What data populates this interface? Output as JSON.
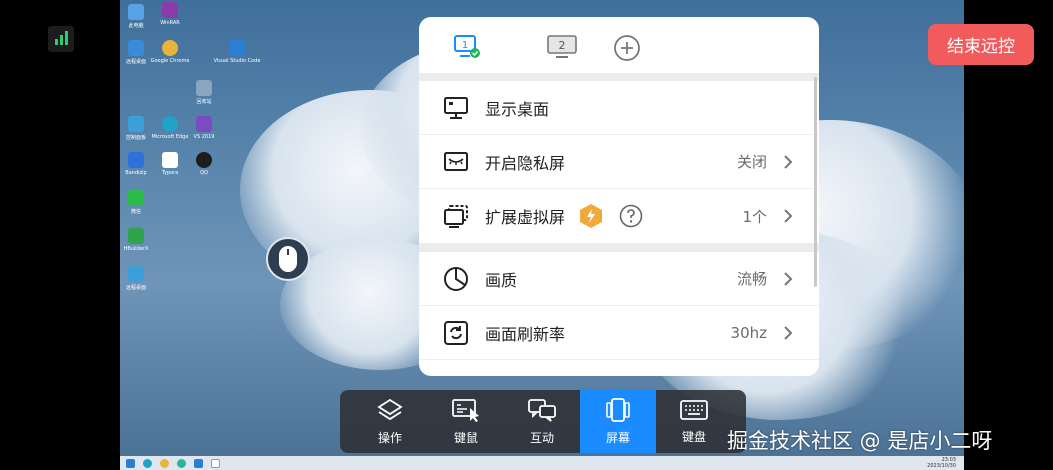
{
  "desktop": {
    "icons": [
      {
        "label": "此电脑",
        "color": "#5aa2e6"
      },
      {
        "label": "WinRAR",
        "color": "#8b3ca8"
      },
      {
        "label": "远程桌面",
        "color": "#3b8ad9"
      },
      {
        "label": "Google Chrome",
        "color": "#e8b53a"
      },
      {
        "label": "Visual Studio Code",
        "color": "#2a7fd4"
      },
      {
        "label": "回收站",
        "color": "#8aa5c0"
      },
      {
        "label": "Microsoft Edge",
        "color": "#1fa3c9"
      },
      {
        "label": "VS 2019",
        "color": "#7b4bc4"
      },
      {
        "label": "Bandizip",
        "color": "#2f6fd8"
      },
      {
        "label": "Typora",
        "color": "#ffffff"
      },
      {
        "label": "QQ",
        "color": "#1d1d1d"
      },
      {
        "label": "微信",
        "color": "#2dbb4c"
      },
      {
        "label": "HBuilderX",
        "color": "#2ea44f"
      },
      {
        "label": "控制面板",
        "color": "#3b9fd9"
      }
    ],
    "taskbar_clock": {
      "time": "23:03",
      "date": "2023/10/30"
    }
  },
  "end_remote_label": "结束远控",
  "panel": {
    "tabs": [
      {
        "label": "1",
        "name": "screen-1"
      },
      {
        "label": "2",
        "name": "screen-2"
      }
    ],
    "rows": [
      {
        "name": "show-desktop",
        "label": "显示桌面",
        "value": ""
      },
      {
        "name": "privacy-screen",
        "label": "开启隐私屏",
        "value": "关闭"
      },
      {
        "name": "virtual-screen",
        "label": "扩展虚拟屏",
        "value": "1个"
      },
      {
        "name": "quality",
        "label": "画质",
        "value": "流畅"
      },
      {
        "name": "refresh-rate",
        "label": "画面刷新率",
        "value": "30hz"
      }
    ]
  },
  "toolbar": {
    "items": [
      {
        "label": "操作",
        "name": "operation"
      },
      {
        "label": "键鼠",
        "name": "keyboard-mouse"
      },
      {
        "label": "互动",
        "name": "interaction"
      },
      {
        "label": "屏幕",
        "name": "screen"
      },
      {
        "label": "键盘",
        "name": "keyboard"
      }
    ],
    "active": "屏幕"
  },
  "watermark": "掘金技术社区 @ 是店小二呀",
  "colors": {
    "accent": "#1a8cff",
    "end_button": "#f25b5b",
    "toolbar_bg": "#2d3035",
    "badge": "#f2a93b"
  }
}
